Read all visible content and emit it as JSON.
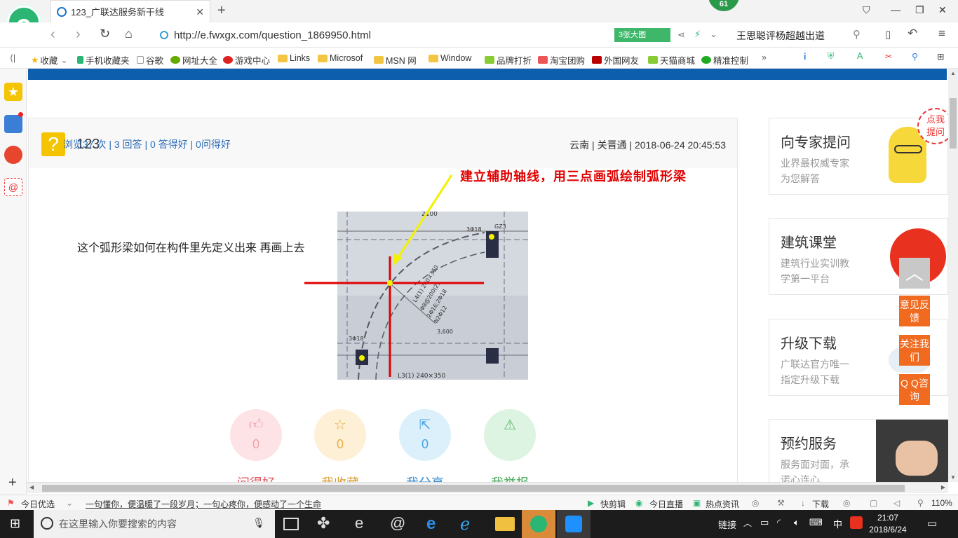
{
  "tab": {
    "title": "123_广联达服务新干线"
  },
  "badge": "61",
  "address": {
    "url": "http://e.fwxgx.com/question_1869950.html",
    "big_image_label": "3张大图",
    "search_text": "王思聪评杨超越出道"
  },
  "favorites": [
    "收藏",
    "手机收藏夹",
    "谷歌",
    "网址大全",
    "游戏中心",
    "Links",
    "Microsof",
    "MSN 网",
    "Window",
    "品牌打折",
    "淘宝团购",
    "外国网友",
    "天猫商城",
    "精准控制"
  ],
  "question": {
    "title": "123",
    "meta": "云南 | 关晋通 | 2018-06-24 20:45:53",
    "stats": "浏览37 次 | 3 回答 | 0 答得好 | 0问得好",
    "body": "这个弧形梁如何在构件里先定义出来  再画上去",
    "annotation": "建立辅助轴线，用三点画弧绘制弧形梁"
  },
  "photo_texts": {
    "dim": "2100",
    "col1": "3Φ18",
    "col2": "GZ3",
    "beam": "L4(1) 240×350",
    "l1": "Φ8@200(2)",
    "l2": "2Φ16;2Φ18",
    "l3": "N2Φ12",
    "dim2": "3,600",
    "bottom": "L3(1) 240×350",
    "left": "3Φ18"
  },
  "actions": [
    {
      "count": "0",
      "label": "问得好",
      "color": "#f2a0a8",
      "bg": "#fde3e6"
    },
    {
      "count": "0",
      "label": "我收藏",
      "color": "#e6b14a",
      "bg": "#fdf0d6"
    },
    {
      "count": "0",
      "label": "我分享",
      "color": "#4aa3e0",
      "bg": "#dcf0fc"
    },
    {
      "count": "0",
      "label": "我举报",
      "color": "#58b86a",
      "bg": "#def4e2"
    }
  ],
  "sidebar": [
    {
      "title": "向专家提问",
      "d1": "业界最权威专家",
      "d2": "为您解答"
    },
    {
      "title": "建筑课堂",
      "d1": "建筑行业实训教",
      "d2": "学第一平台"
    },
    {
      "title": "升级下载",
      "d1": "广联达官方唯一",
      "d2": "指定升级下载"
    },
    {
      "title": "预约服务",
      "d1": "服务面对面，承",
      "d2": "诺心连心"
    }
  ],
  "ask_bubble": [
    "点我",
    "提问"
  ],
  "float_buttons": {
    "feedback": "意见反馈",
    "follow": "关注我们",
    "qq": "Q Q咨询"
  },
  "statusbar": {
    "left": "今日优选",
    "news": "一句懂你，便温暖了一段岁月；一句心疼你，便感动了一个生命",
    "items": [
      "快剪辑",
      "今日直播",
      "热点资讯",
      "下载"
    ],
    "zoom": "110%"
  },
  "taskbar": {
    "search_placeholder": "在这里输入你要搜索的内容",
    "link_label": "链接",
    "ime": "中",
    "time": "21:07",
    "date": "2018/6/24"
  }
}
